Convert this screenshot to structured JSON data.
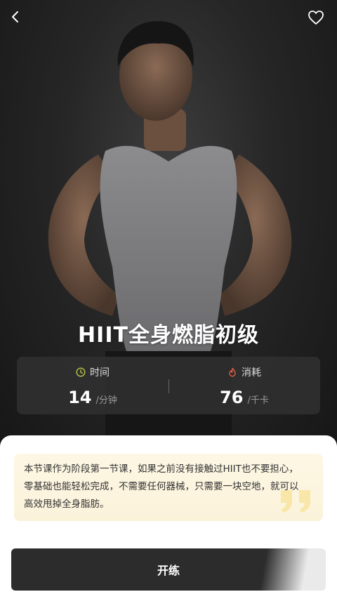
{
  "header": {
    "back_icon": "chevron-left-icon",
    "favorite_icon": "heart-outline-icon"
  },
  "course": {
    "title": "HIIT全身燃脂初级"
  },
  "stats": {
    "time": {
      "icon": "clock-icon",
      "label": "时间",
      "value": "14",
      "unit": "/分钟"
    },
    "calories": {
      "icon": "flame-icon",
      "label": "消耗",
      "value": "76",
      "unit": "/千卡"
    }
  },
  "description": {
    "line1": "本节课作为阶段第一节课，如果之前没有接触过HIIT也不要担心，",
    "line2": "零基础也能轻松完成，不需要任何器械，只需要一块空地，就可以",
    "line3": "高效甩掉全身脂肪。",
    "quote_icon": "quote-mark-icon"
  },
  "actions": {
    "start_label": "开练"
  },
  "colors": {
    "time_icon": "#b5c24a",
    "flame_icon": "#e8634a",
    "description_bg": "#fcf5df",
    "quote": "#f6e39a"
  }
}
